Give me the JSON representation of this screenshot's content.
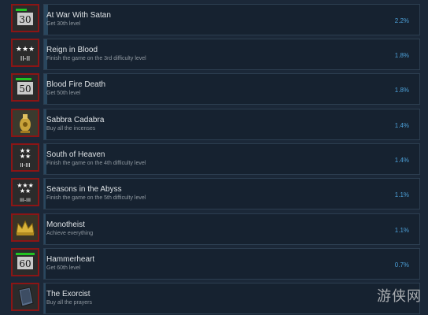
{
  "achievements": [
    {
      "title": "At War With Satan",
      "desc": "Get 30th level",
      "percent": "2.2%",
      "icon": "level-30-icon",
      "badge": "30"
    },
    {
      "title": "Reign in Blood",
      "desc": "Finish the game on the 3rd difficulty level",
      "percent": "1.8%",
      "icon": "difficulty-3-icon",
      "badge": "II-II"
    },
    {
      "title": "Blood Fire Death",
      "desc": "Get 50th level",
      "percent": "1.8%",
      "icon": "level-50-icon",
      "badge": "50"
    },
    {
      "title": "Sabbra Cadabra",
      "desc": "Buy all the incenses",
      "percent": "1.4%",
      "icon": "incense-icon",
      "badge": ""
    },
    {
      "title": "South of Heaven",
      "desc": "Finish the game on the 4th difficulty level",
      "percent": "1.4%",
      "icon": "difficulty-4-icon",
      "badge": "II-III"
    },
    {
      "title": "Seasons in the Abyss",
      "desc": "Finish the game on the 5th difficulty level",
      "percent": "1.1%",
      "icon": "difficulty-5-icon",
      "badge": "III-III"
    },
    {
      "title": "Monotheist",
      "desc": "Achieve everything",
      "percent": "1.1%",
      "icon": "crown-icon",
      "badge": ""
    },
    {
      "title": "Hammerheart",
      "desc": "Get 60th level",
      "percent": "0.7%",
      "icon": "level-60-icon",
      "badge": "60"
    },
    {
      "title": "The Exorcist",
      "desc": "Buy all the prayers",
      "percent": "",
      "icon": "prayer-book-icon",
      "badge": ""
    }
  ],
  "colors": {
    "icon_border": "#8b1515",
    "percent_text": "#4c9fd6",
    "bar_fill": "#2a475e"
  },
  "watermark": "游侠网"
}
